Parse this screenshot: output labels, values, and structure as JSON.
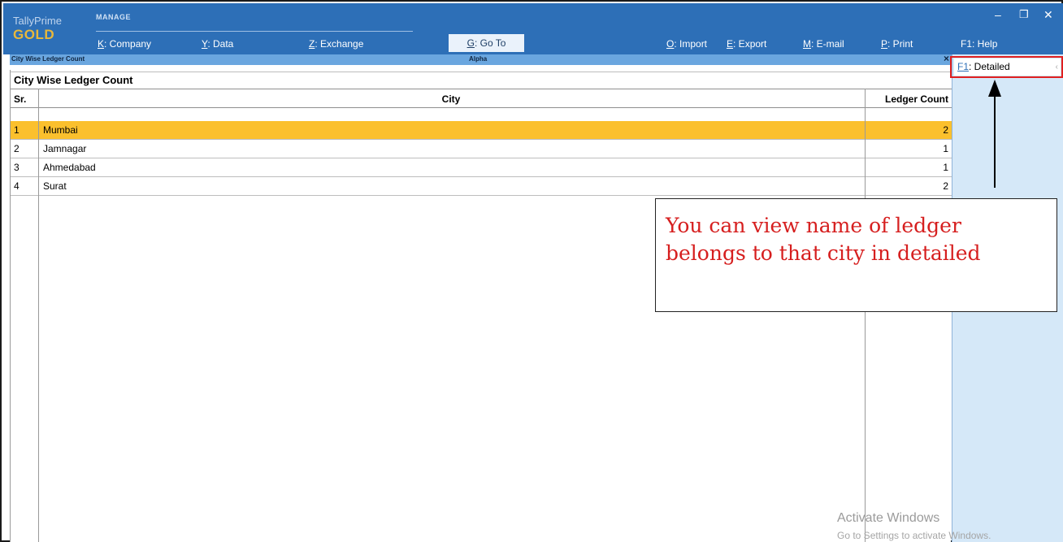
{
  "app": {
    "brand_name": "TallyPrime",
    "brand_edition": "GOLD",
    "manage_label": "MANAGE"
  },
  "menu": {
    "company": {
      "key": "K",
      "label": ": Company"
    },
    "data": {
      "key": "Y",
      "label": ": Data"
    },
    "exchange": {
      "key": "Z",
      "label": ": Exchange"
    },
    "goto": {
      "key": "G",
      "label": ": Go To"
    },
    "import": {
      "key": "O",
      "label": ": Import"
    },
    "export": {
      "key": "E",
      "label": ": Export"
    },
    "email": {
      "key": "M",
      "label": ": E-mail"
    },
    "print": {
      "key": "P",
      "label": ": Print"
    },
    "help": {
      "key": "F1",
      "label": ": Help"
    }
  },
  "window_controls": {
    "minimize": "–",
    "restore": "❐",
    "close": "✕"
  },
  "title_strip": {
    "left": "City Wise Ledger Count",
    "center": "Alpha",
    "close": "×"
  },
  "report": {
    "title": "City Wise Ledger Count",
    "columns": {
      "sr": "Sr.",
      "city": "City",
      "count": "Ledger Count"
    },
    "rows": [
      {
        "sr": "1",
        "city": "Mumbai",
        "count": "2"
      },
      {
        "sr": "2",
        "city": "Jamnagar",
        "count": "1"
      },
      {
        "sr": "3",
        "city": "Ahmedabad",
        "count": "1"
      },
      {
        "sr": "4",
        "city": "Surat",
        "count": "2"
      }
    ]
  },
  "right_panel": {
    "detailed": {
      "key": "F1",
      "label": ": Detailed",
      "chevron": "‹"
    }
  },
  "callout": {
    "line1": "You can view name of ledger",
    "line2": "belongs to that city in detailed"
  },
  "watermark": {
    "line1": "Activate Windows",
    "line2": "Go to Settings to activate Windows."
  },
  "colors": {
    "topbar": "#2d6fb7",
    "selected_row": "#fbc02d",
    "callout_text": "#d61f1f",
    "highlight_border": "#e02020"
  }
}
